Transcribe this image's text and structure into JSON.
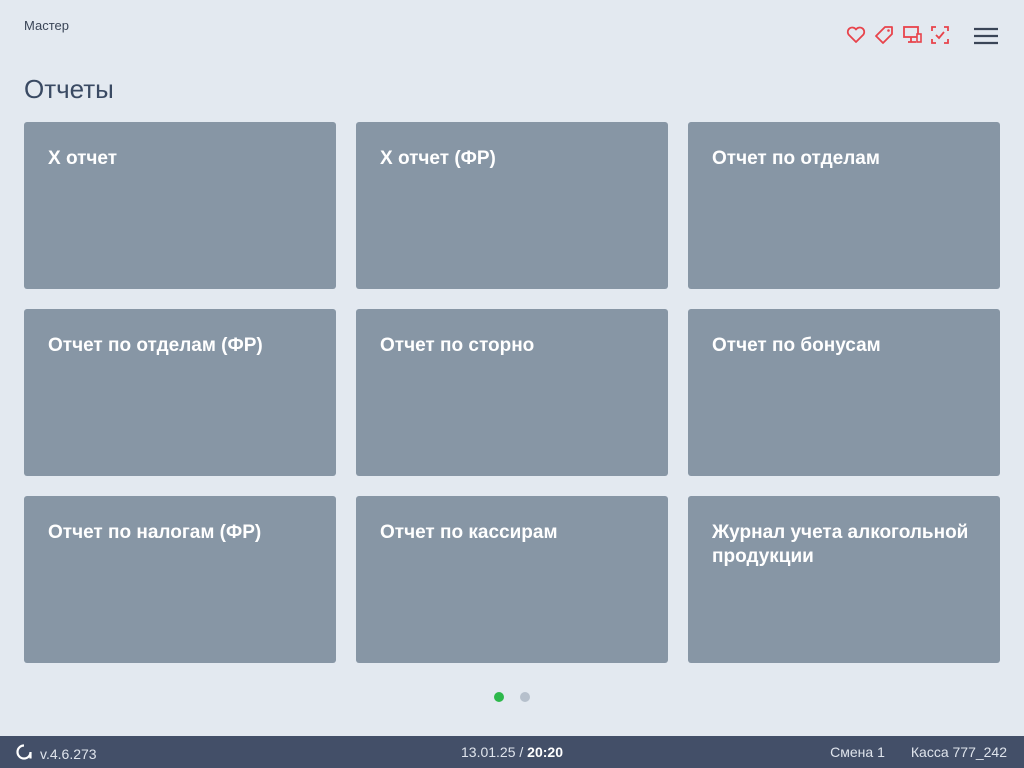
{
  "header": {
    "user_role": "Мастер",
    "icons": [
      "heart-icon",
      "tag-icon",
      "monitor-icon",
      "scan-check-icon",
      "hamburger-menu-icon"
    ],
    "icon_color": "#e8434b"
  },
  "page": {
    "title": "Отчеты"
  },
  "tiles": [
    {
      "label": "X отчет"
    },
    {
      "label": "X отчет (ФР)"
    },
    {
      "label": "Отчет по отделам"
    },
    {
      "label": "Отчет по отделам (ФР)"
    },
    {
      "label": "Отчет по сторно"
    },
    {
      "label": "Отчет по бонусам"
    },
    {
      "label": "Отчет по налогам (ФР)"
    },
    {
      "label": "Отчет по кассирам"
    },
    {
      "label": "Журнал учета алкогольной продукции"
    }
  ],
  "pagination": {
    "pages": 2,
    "current": 1,
    "active_color": "#2db84b"
  },
  "status_bar": {
    "version": "v.4.6.273",
    "date": "13.01.25",
    "separator": "/",
    "time": "20:20",
    "shift": "Смена 1",
    "register": "Касса 777_242"
  }
}
